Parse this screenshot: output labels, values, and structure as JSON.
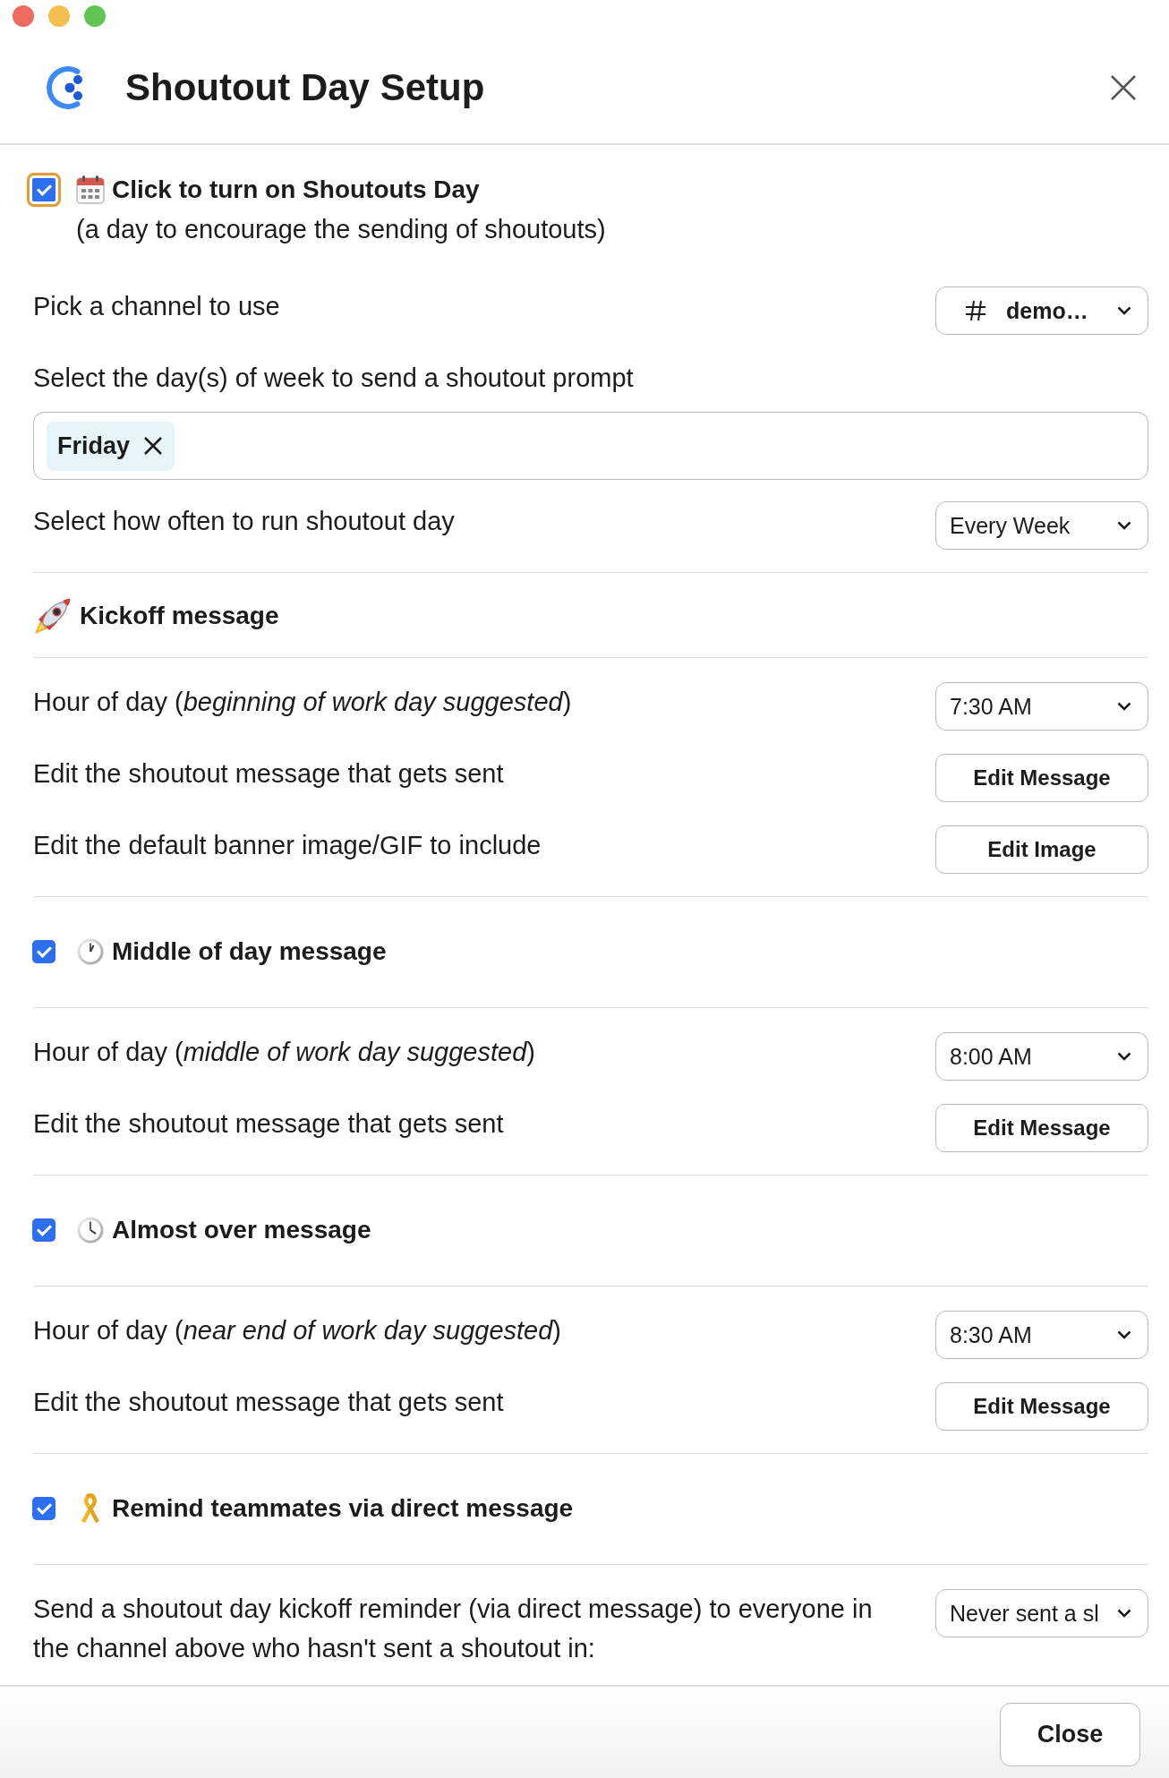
{
  "window": {
    "title": "Shoutout Day Setup"
  },
  "enable": {
    "checked": true,
    "focused": true,
    "label": "Click to turn on Shoutouts Day",
    "note": "(a day to encourage the sending of shoutouts)"
  },
  "general": [
    {
      "kind": "channel-select",
      "label": "Pick a channel to use",
      "value": "demo…"
    },
    {
      "kind": "multi-select",
      "label": "Select the day(s) of week to send a shoutout prompt",
      "tags": [
        "Friday"
      ]
    },
    {
      "kind": "select",
      "label": "Select how often to run shoutout day",
      "value": "Every Week"
    }
  ],
  "sections": [
    {
      "kind": "heading",
      "title": "Kickoff message",
      "rows": [
        {
          "kind": "select",
          "label": "Hour of day (*beginning of work day suggested*)",
          "value": "7:30 AM"
        },
        {
          "kind": "button",
          "label": "Edit the shoutout message that gets sent",
          "button": "Edit Message"
        },
        {
          "kind": "button",
          "label": "Edit the default banner image/GIF to include",
          "button": "Edit Image"
        }
      ]
    },
    {
      "kind": "toggle",
      "checked": true,
      "title": "Middle of day message",
      "rows": [
        {
          "kind": "select",
          "label": "Hour of day (*middle of work day suggested*)",
          "value": "8:00 AM"
        },
        {
          "kind": "button",
          "label": "Edit the shoutout message that gets sent",
          "button": "Edit Message"
        }
      ]
    },
    {
      "kind": "toggle",
      "checked": true,
      "title": "Almost over message",
      "rows": [
        {
          "kind": "select",
          "label": "Hour of day (*near end of work day suggested*)",
          "value": "8:30 AM"
        },
        {
          "kind": "button",
          "label": "Edit the shoutout message that gets sent",
          "button": "Edit Message"
        }
      ]
    },
    {
      "kind": "toggle",
      "checked": true,
      "title": "Remind teammates via direct message",
      "rows": [
        {
          "kind": "select",
          "label": "Send a shoutout day kickoff reminder (via direct message) to everyone in the channel above who hasn't sent a shoutout in:",
          "value": "Never sent a sl"
        }
      ]
    }
  ],
  "footer": {
    "buttons": [
      "Close"
    ]
  }
}
